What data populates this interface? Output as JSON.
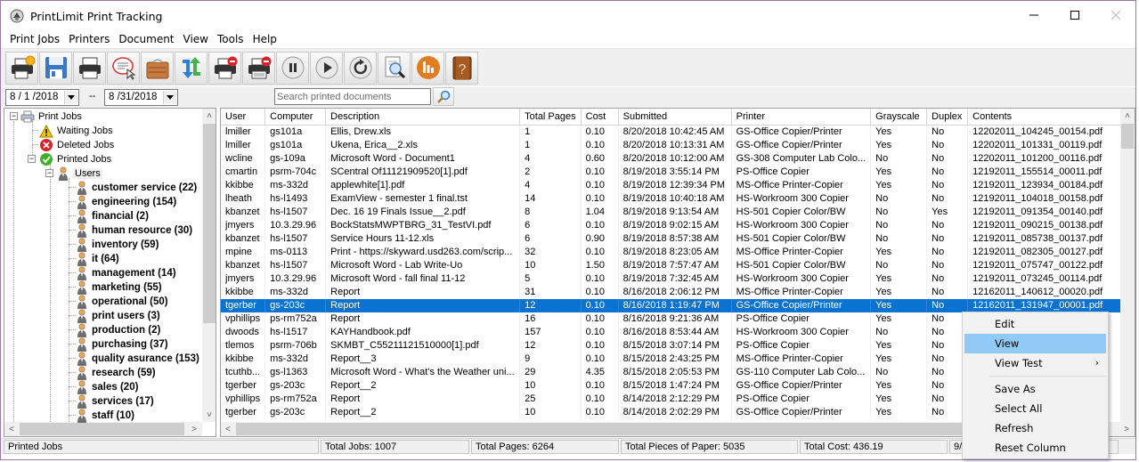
{
  "window": {
    "title": "PrintLimit Print Tracking",
    "controls": {
      "minimize": "minimize",
      "maximize": "maximize",
      "close": "close"
    }
  },
  "menu": [
    "Print Jobs",
    "Printers",
    "Document",
    "View",
    "Tools",
    "Help"
  ],
  "toolbar": {
    "buttons": [
      "new-printer-icon",
      "save-icon",
      "printer-icon",
      "comment-icon",
      "briefcase-icon",
      "refresh-arrows-icon",
      "delete-printer-job-icon",
      "delete-printer-all-icon",
      "pause-icon",
      "play-icon",
      "restart-icon",
      "preview-search-icon",
      "reports-chart-icon",
      "help-book-icon"
    ]
  },
  "filter": {
    "date_from": "8 / 1 /2018",
    "date_separator": "--",
    "date_to": "8 /31/2018",
    "search_placeholder": "Search printed documents",
    "search_value": ""
  },
  "tree": {
    "root": "Print Jobs",
    "waiting": "Waiting Jobs",
    "deleted": "Deleted Jobs",
    "printed": "Printed Jobs",
    "users": "Users",
    "groups": [
      "customer service (22)",
      "engineering (154)",
      "financial (2)",
      "human resource (30)",
      "inventory (59)",
      "it (64)",
      "management (14)",
      "marketing (55)",
      "operational (50)",
      "print users (3)",
      "production (2)",
      "purchasing (37)",
      "quality asurance (153)",
      "research (59)",
      "sales (20)",
      "services (17)",
      "staff (10)"
    ]
  },
  "grid": {
    "columns": [
      "User",
      "Computer",
      "Description",
      "Total Pages",
      "Cost",
      "Submitted",
      "Printer",
      "Grayscale",
      "Duplex",
      "Contents"
    ],
    "selected_index": 13,
    "rows": [
      [
        "lmiller",
        "gs101a",
        "Ellis, Drew.xls",
        "1",
        "0.10",
        "8/20/2018 10:42:45 AM",
        "GS-Office Copier/Printer",
        "Yes",
        "No",
        "12202011_104245_00154.pdf"
      ],
      [
        "lmiller",
        "gs101a",
        "Ukena, Erica__2.xls",
        "1",
        "0.10",
        "8/20/2018 10:13:31 AM",
        "GS-Office Copier/Printer",
        "Yes",
        "No",
        "12202011_101331_00119.pdf"
      ],
      [
        "wcline",
        "gs-109a",
        "Microsoft Word - Document1",
        "4",
        "0.60",
        "8/20/2018 10:12:00 AM",
        "GS-308 Computer Lab Colo...",
        "No",
        "No",
        "12202011_101200_00116.pdf"
      ],
      [
        "cmartin",
        "psrm-704c",
        "SCentral Of11121909520[1].pdf",
        "2",
        "0.10",
        "8/19/2018 3:55:14 PM",
        "PS-Office Copier",
        "Yes",
        "No",
        "12192011_155514_00011.pdf"
      ],
      [
        "kkibbe",
        "ms-332d",
        "applewhite[1].pdf",
        "4",
        "0.10",
        "8/19/2018 12:39:34 PM",
        "MS-Office Printer-Copier",
        "Yes",
        "No",
        "12192011_123934_00184.pdf"
      ],
      [
        "lheath",
        "hs-l1493",
        "ExamView - semester 1 final.tst",
        "14",
        "0.10",
        "8/19/2018 10:40:18 AM",
        "HS-Workroom 300 Copier",
        "No",
        "No",
        "12192011_104018_00158.pdf"
      ],
      [
        "kbanzet",
        "hs-l1507",
        "Dec. 16  19 Finals Issue__2.pdf",
        "8",
        "1.04",
        "8/19/2018 9:13:54 AM",
        "HS-501 Copier Color/BW",
        "No",
        "Yes",
        "12192011_091354_00140.pdf"
      ],
      [
        "jmyers",
        "10.3.29.96",
        "BockStatsMWPTBRG_31_TestVI.pdf",
        "6",
        "0.10",
        "8/19/2018 9:02:15 AM",
        "HS-Workroom 300 Copier",
        "No",
        "No",
        "12192011_090215_00138.pdf"
      ],
      [
        "kbanzet",
        "hs-l1507",
        "Service Hours 11-12.xls",
        "6",
        "0.90",
        "8/19/2018 8:57:38 AM",
        "HS-501 Copier Color/BW",
        "No",
        "No",
        "12192011_085738_00137.pdf"
      ],
      [
        "mpine",
        "ms-0113",
        "Print - https://skyward.usd263.com/scrip...",
        "32",
        "0.10",
        "8/19/2018 8:23:05 AM",
        "MS-Office Printer-Copier",
        "Yes",
        "No",
        "12192011_082305_00127.pdf"
      ],
      [
        "kbanzet",
        "hs-l1507",
        "Microsoft Word - Lab Write-Uo",
        "10",
        "1.50",
        "8/19/2018 7:57:47 AM",
        "HS-501 Copier Color/BW",
        "No",
        "No",
        "12192011_075747_00122.pdf"
      ],
      [
        "jmyers",
        "10.3.29.96",
        "Microsoft Word - fall final 11-12",
        "5",
        "0.10",
        "8/19/2018 7:32:45 AM",
        "HS-Workroom 300 Copier",
        "Yes",
        "No",
        "12192011_073245_00114.pdf"
      ],
      [
        "kkibbe",
        "ms-332d",
        "Report",
        "31",
        "0.10",
        "8/16/2018 2:06:12 PM",
        "MS-Office Printer-Copier",
        "Yes",
        "No",
        "12162011_140612_00020.pdf"
      ],
      [
        "tgerber",
        "gs-203c",
        "Report",
        "12",
        "0.10",
        "8/16/2018 1:19:47 PM",
        "GS-Office Copier/Printer",
        "Yes",
        "No",
        "12162011_131947_00001.pdf"
      ],
      [
        "vphillips",
        "ps-rm752a",
        "Report",
        "16",
        "0.10",
        "8/16/2018 9:21:36 AM",
        "PS-Office Copier",
        "Yes",
        "No",
        ""
      ],
      [
        "dwoods",
        "hs-l1517",
        "KAYHandbook.pdf",
        "157",
        "0.10",
        "8/16/2018 8:53:44 AM",
        "HS-Workroom 300 Copier",
        "No",
        "No",
        ""
      ],
      [
        "tlemos",
        "psrm-706b",
        "SKMBT_C55211121510000[1].pdf",
        "12",
        "0.10",
        "8/15/2018 3:07:14 PM",
        "PS-Office Copier",
        "Yes",
        "No",
        ""
      ],
      [
        "kkibbe",
        "ms-332d",
        "Report__3",
        "9",
        "0.10",
        "8/15/2018 2:43:25 PM",
        "MS-Office Printer-Copier",
        "Yes",
        "No",
        ""
      ],
      [
        "tcuthb...",
        "gs-l1363",
        "Microsoft Word - What's the Weather uni...",
        "29",
        "4.35",
        "8/15/2018 2:05:53 PM",
        "GS-110 Computer Lab Colo...",
        "No",
        "No",
        ""
      ],
      [
        "tgerber",
        "gs-203c",
        "Report__2",
        "10",
        "0.10",
        "8/15/2018 1:47:24 PM",
        "GS-Office Copier/Printer",
        "Yes",
        "No",
        ""
      ],
      [
        "vphillips",
        "ps-rm752a",
        "Report",
        "25",
        "0.10",
        "8/14/2018 2:12:29 PM",
        "PS-Office Copier",
        "Yes",
        "No",
        ""
      ],
      [
        "tgerber",
        "gs-203c",
        "Report__2",
        "10",
        "0.10",
        "8/14/2018 2:02:29 PM",
        "GS-Office Copier/Printer",
        "Yes",
        "No",
        ""
      ]
    ]
  },
  "status": {
    "section": "Printed Jobs",
    "total_jobs": "Total Jobs: 1007",
    "total_pages": "Total Pages: 6264",
    "total_paper": "Total Pieces of Paper: 5035",
    "total_cost": "Total Cost: 436.19",
    "date": "9/1"
  },
  "context_menu": {
    "items": [
      {
        "label": "Edit"
      },
      {
        "label": "View",
        "hover": true
      },
      {
        "label": "View Test",
        "submenu": true
      },
      {
        "separator": true
      },
      {
        "label": "Save As"
      },
      {
        "label": "Select All"
      },
      {
        "label": "Refresh"
      },
      {
        "label": "Reset Column"
      }
    ]
  },
  "colors": {
    "selection": "#0a73d2",
    "menu_hover": "#91c9f7",
    "window_border": "#9a7aa8"
  }
}
